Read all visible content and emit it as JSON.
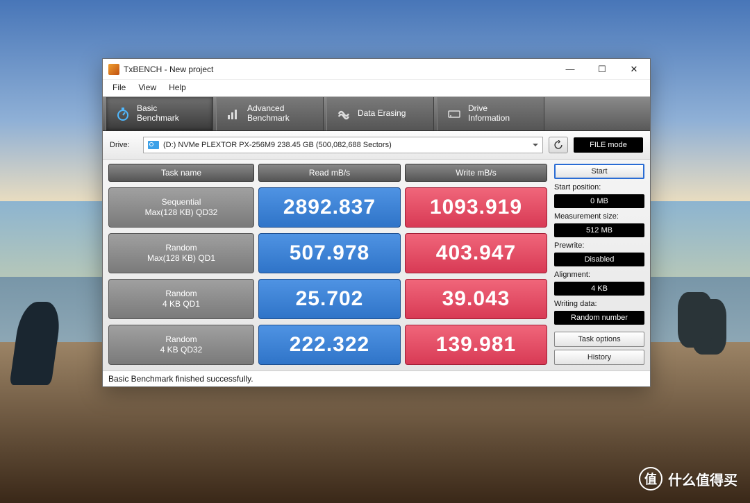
{
  "window": {
    "title": "TxBENCH - New project"
  },
  "menu": {
    "file": "File",
    "view": "View",
    "help": "Help"
  },
  "tabs": {
    "basic": {
      "line1": "Basic",
      "line2": "Benchmark"
    },
    "adv": {
      "line1": "Advanced",
      "line2": "Benchmark"
    },
    "erase": {
      "line1": "Data Erasing"
    },
    "drive": {
      "line1": "Drive",
      "line2": "Information"
    }
  },
  "drive_row": {
    "label": "Drive:",
    "selected": "(D:) NVMe PLEXTOR PX-256M9  238.45 GB (500,082,688 Sectors)",
    "mode_button": "FILE mode"
  },
  "headers": {
    "task": "Task name",
    "read": "Read mB/s",
    "write": "Write mB/s"
  },
  "rows": [
    {
      "name1": "Sequential",
      "name2": "Max(128 KB) QD32",
      "read": "2892.837",
      "write": "1093.919"
    },
    {
      "name1": "Random",
      "name2": "Max(128 KB) QD1",
      "read": "507.978",
      "write": "403.947"
    },
    {
      "name1": "Random",
      "name2": "4 KB QD1",
      "read": "25.702",
      "write": "39.043"
    },
    {
      "name1": "Random",
      "name2": "4 KB QD32",
      "read": "222.322",
      "write": "139.981"
    }
  ],
  "side": {
    "start": "Start",
    "start_pos_label": "Start position:",
    "start_pos": "0 MB",
    "meas_label": "Measurement size:",
    "meas": "512 MB",
    "prewrite_label": "Prewrite:",
    "prewrite": "Disabled",
    "align_label": "Alignment:",
    "align": "4 KB",
    "writing_label": "Writing data:",
    "writing": "Random number",
    "task_options": "Task options",
    "history": "History"
  },
  "status": "Basic Benchmark finished successfully.",
  "watermark": {
    "badge": "值",
    "text": "什么值得买"
  },
  "chart_data": {
    "type": "table",
    "title": "TxBENCH Basic Benchmark",
    "columns": [
      "Task name",
      "Read mB/s",
      "Write mB/s"
    ],
    "categories": [
      "Sequential Max(128 KB) QD32",
      "Random Max(128 KB) QD1",
      "Random 4 KB QD1",
      "Random 4 KB QD32"
    ],
    "series": [
      {
        "name": "Read mB/s",
        "values": [
          2892.837,
          507.978,
          25.702,
          222.322
        ]
      },
      {
        "name": "Write mB/s",
        "values": [
          1093.919,
          403.947,
          39.043,
          139.981
        ]
      }
    ]
  }
}
